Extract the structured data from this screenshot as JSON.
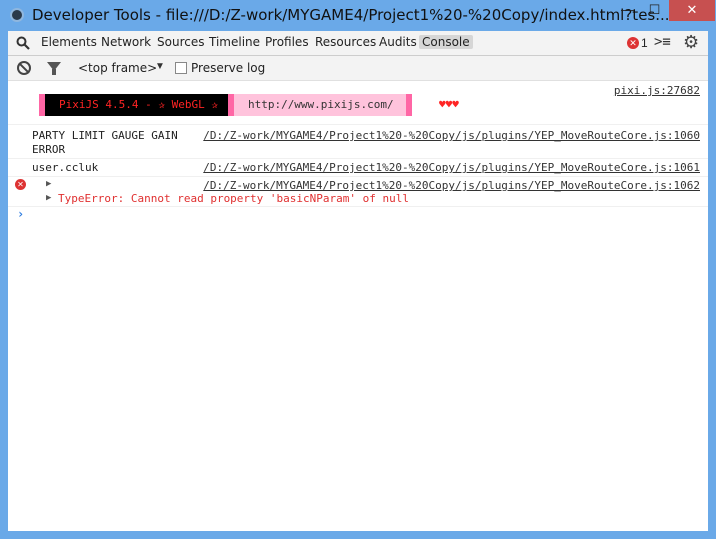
{
  "window": {
    "title": "Developer Tools - file:///D:/Z-work/MYGAME4/Project1%20-%20Copy/index.html?tes...",
    "minimize": "—",
    "maximize": "☐",
    "close": "✕"
  },
  "tabs": [
    "Elements",
    "Network",
    "Sources",
    "Timeline",
    "Profiles",
    "Resources",
    "Audits",
    "Console"
  ],
  "active_tab": "Console",
  "error_count": "1",
  "toolbar": {
    "frame": "<top frame>",
    "frame_arrow": "▼",
    "preserve_log": "Preserve log"
  },
  "console": {
    "pixi_source": "pixi.js:27682",
    "pixi_banner_left": "PixiJS 4.5.4 - ✰ WebGL ✰",
    "pixi_banner_right": "http://www.pixijs.com/",
    "hearts": "♥♥♥",
    "messages": [
      {
        "text": "PARTY LIMIT GAUGE GAIN",
        "text2": "ERROR",
        "source": "/D:/Z-work/MYGAME4/Project1%20-%20Copy/js/plugins/YEP_MoveRouteCore.js:1060"
      },
      {
        "text": "user.ccluk",
        "source": "/D:/Z-work/MYGAME4/Project1%20-%20Copy/js/plugins/YEP_MoveRouteCore.js:1061"
      },
      {
        "text": "",
        "source": "/D:/Z-work/MYGAME4/Project1%20-%20Copy/js/plugins/YEP_MoveRouteCore.js:1062"
      }
    ],
    "error_text": "TypeError: Cannot read property 'basicNParam' of null",
    "prompt": "›"
  },
  "colors": {
    "title_bg": "#6aa9e8",
    "close_bg": "#c75050",
    "error_red": "#e03030",
    "pixi_pink": "#ff66a5",
    "pixi_light": "#ffc3dc",
    "prompt_blue": "#2f7de0"
  }
}
